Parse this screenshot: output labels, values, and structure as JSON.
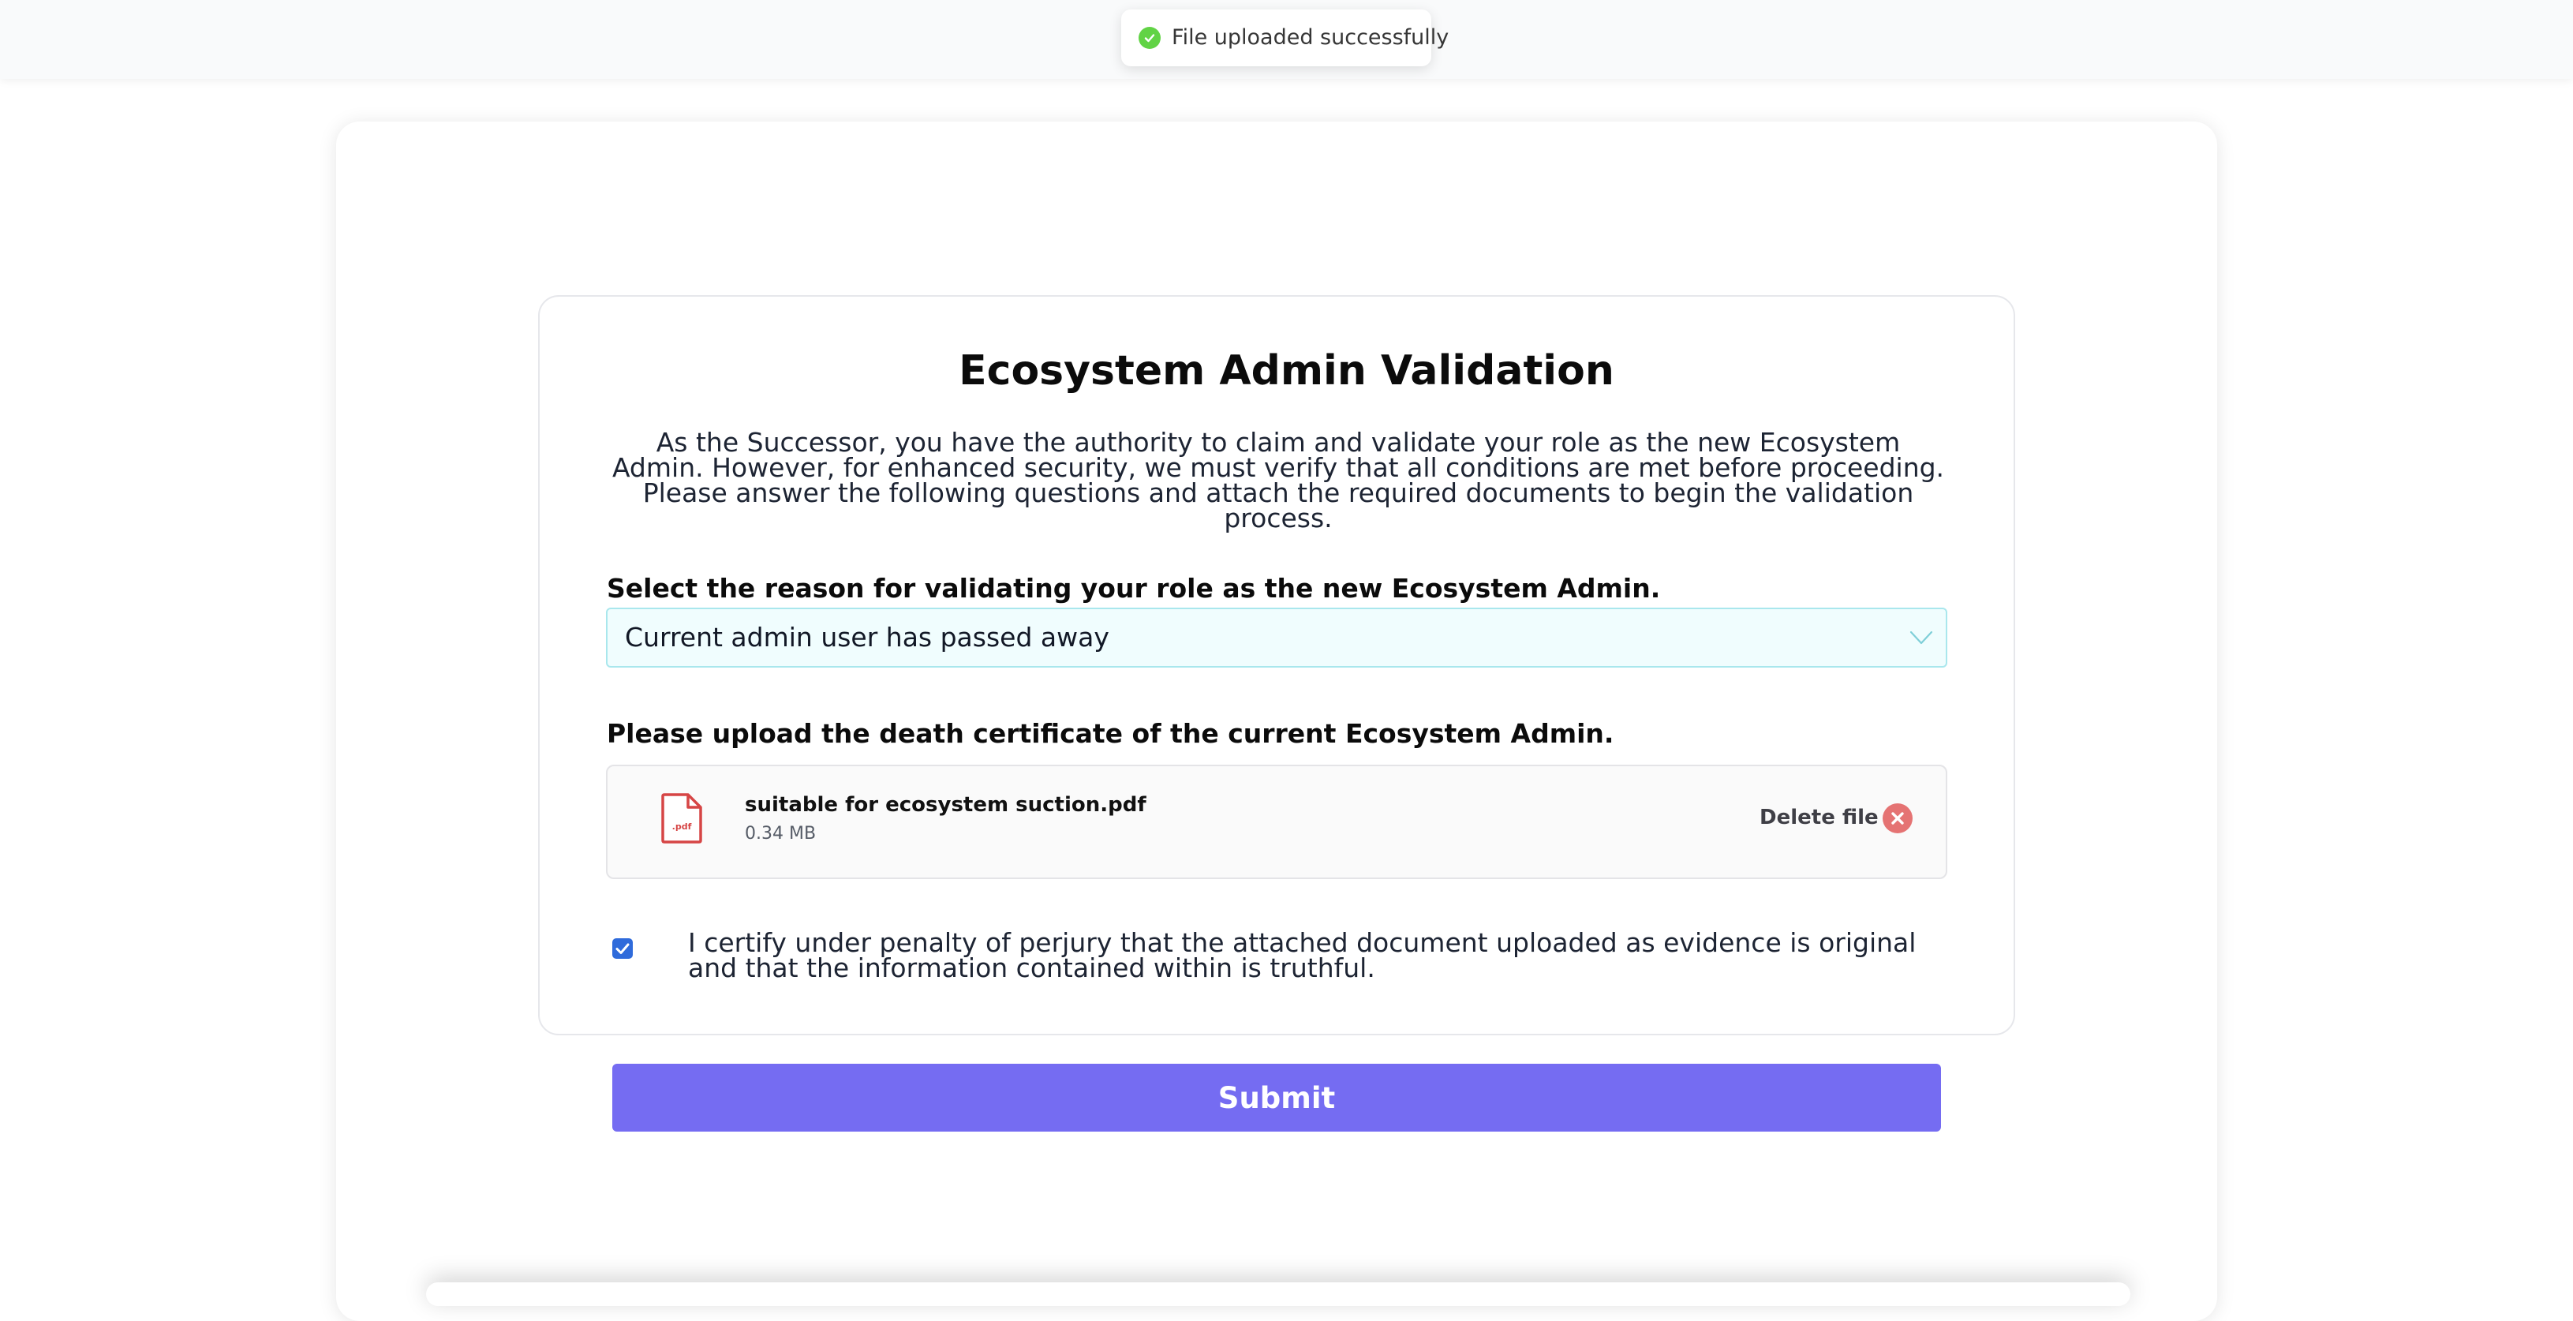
{
  "toast": {
    "message": "File uploaded successfully",
    "icon": "check-circle-icon",
    "icon_color": "#61d345"
  },
  "form": {
    "title": "Ecosystem Admin Validation",
    "description": "As the Successor, you have the authority to claim and validate your role as the new Ecosystem Admin.  However, for enhanced security, we must verify that all conditions are met before proceeding. Please answer the following questions and attach the required documents to begin the validation process.",
    "reason": {
      "label": "Select the reason for validating your role as the new Ecosystem Admin.",
      "selected_value": "Current admin user has passed away",
      "chevron_icon": "chevron-down-icon"
    },
    "upload": {
      "label": "Please upload the death certificate of the current Ecosystem Admin.",
      "file": {
        "icon": "pdf-file-icon",
        "icon_label": ".pdf",
        "name": "suitable for ecosystem suction.pdf",
        "size": "0.34 MB",
        "delete_label": "Delete file",
        "delete_icon": "close-circle-icon"
      }
    },
    "certify": {
      "checked": true,
      "text": "I certify under penalty of perjury that the attached document uploaded as evidence is original and that the information contained within is truthful."
    },
    "submit_label": "Submit"
  },
  "colors": {
    "accent": "#756cf2",
    "select_bg": "#f0fdfe",
    "select_border": "#a9e7ed",
    "pdf_red": "#d64545",
    "delete_red": "#e57373",
    "checkbox_blue": "#2f6bdb"
  }
}
